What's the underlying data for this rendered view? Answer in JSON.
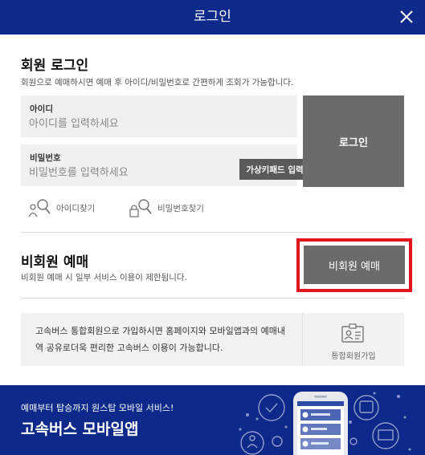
{
  "header": {
    "title": "로그인"
  },
  "member_login": {
    "title": "회원 로그인",
    "description": "회원으로 예매하시면 예매 후 아이디/비밀번호로 간편하게 조회가 가능합니다.",
    "id_label": "아이디",
    "id_placeholder": "아이디를 입력하세요",
    "id_value": "",
    "pw_label": "비밀번호",
    "pw_placeholder": "비밀번호를 입력하세요",
    "pw_value": "",
    "virtual_keypad_label": "가상키패드 입력",
    "login_label": "로그인",
    "find_id_label": "아이디찾기",
    "find_pw_label": "비밀번호찾기"
  },
  "non_member": {
    "title": "비회원 예매",
    "description": "비회원 예매 시 일부 서비스 이용이 제한됩니다.",
    "button_label": "비회원 예매"
  },
  "integrated": {
    "text": "고속버스 통합회원으로 가입하시면 홈페이지와 모바일앱과의 예매내역 공유로더욱 편리한 고속버스 이용이 가능합니다.",
    "join_label": "통합회원가입"
  },
  "banner": {
    "subtitle": "예매부터 탑승까지 원스탑 모바일 서비스!",
    "title": "고속버스 모바일앱"
  },
  "colors": {
    "brand": "#0d2a8a",
    "button_gray": "#6b6b6b",
    "highlight_red": "#e3151c"
  }
}
